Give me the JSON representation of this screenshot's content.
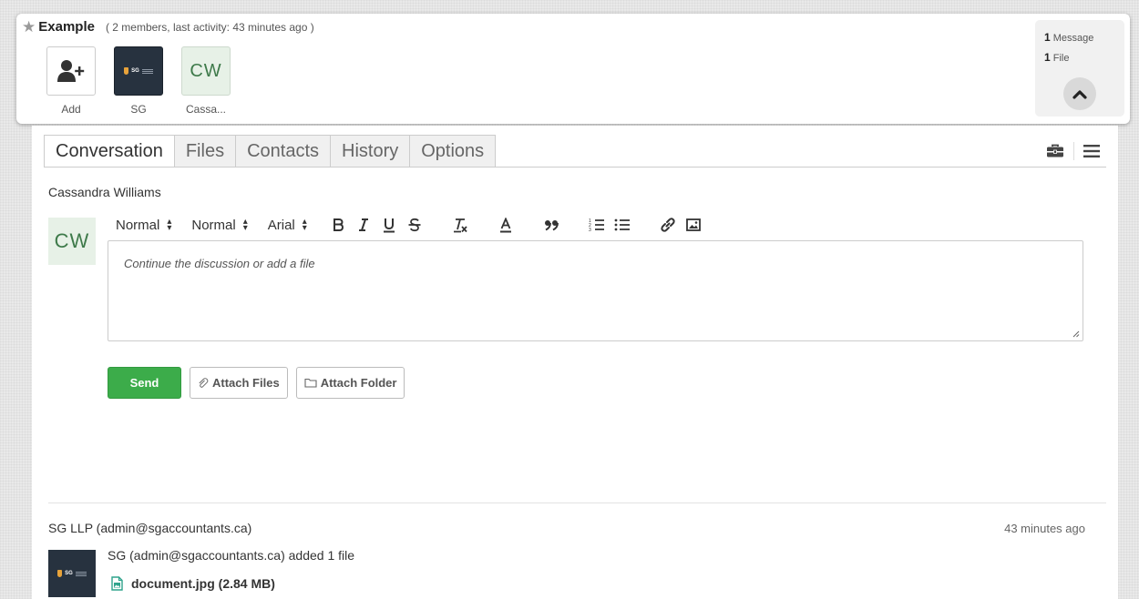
{
  "conversation": {
    "title": "Example",
    "meta": "( 2 members, last activity: 43 minutes ago )"
  },
  "members": [
    {
      "label": "Add",
      "type": "add"
    },
    {
      "label": "SG",
      "type": "logo",
      "logo_text": "SG"
    },
    {
      "label": "Cassa...",
      "type": "initials",
      "initials": "CW"
    }
  ],
  "stats": {
    "messages_count": "1",
    "messages_label": "Message",
    "files_count": "1",
    "files_label": "File"
  },
  "tabs": [
    "Conversation",
    "Files",
    "Contacts",
    "History",
    "Options"
  ],
  "active_tab": "Conversation",
  "composer": {
    "author": "Cassandra Williams",
    "author_initials": "CW",
    "toolbar": {
      "heading_select": "Normal",
      "size_select": "Normal",
      "font_select": "Arial"
    },
    "placeholder": "Continue the discussion or add a file",
    "send_label": "Send",
    "attach_files_label": "Attach Files",
    "attach_folder_label": "Attach Folder"
  },
  "message": {
    "sender": "SG LLP (admin@sgaccountants.ca)",
    "time": "43 minutes ago",
    "text": "SG (admin@sgaccountants.ca) added 1 file",
    "logo_text": "SG",
    "file_name": "document.jpg (2.84 MB)"
  },
  "colors": {
    "accent_green": "#3cac4a",
    "logo_navy": "#27323f",
    "initials_bg": "#e7f1e7",
    "initials_text": "#3e7a4a",
    "file_icon": "#2fa38c"
  }
}
